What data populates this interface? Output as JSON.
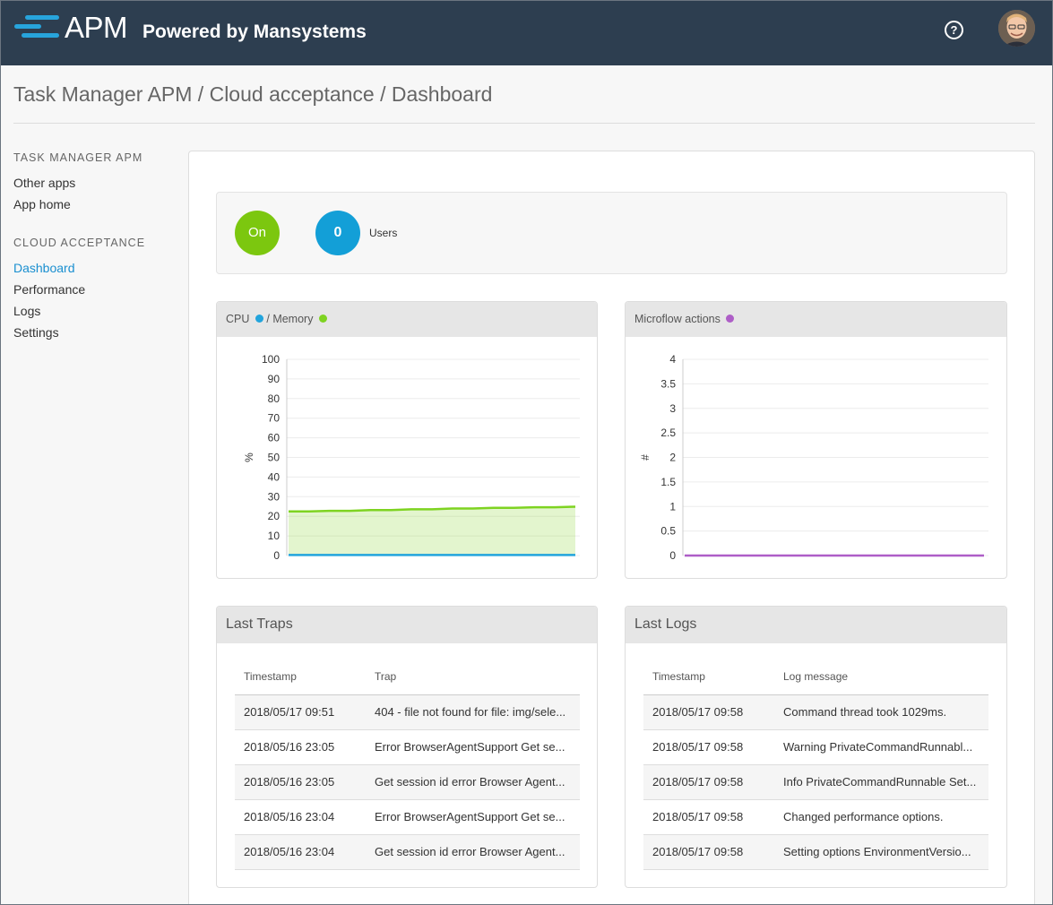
{
  "header": {
    "brand": "APM",
    "powered_by": "Powered by Mansystems",
    "help_icon": "question-circle-icon",
    "avatar": "user-avatar"
  },
  "breadcrumb": "Task Manager APM / Cloud acceptance / Dashboard",
  "sidebar": {
    "sections": [
      {
        "heading": "TASK MANAGER APM",
        "items": [
          {
            "label": "Other apps"
          },
          {
            "label": "App home"
          }
        ]
      },
      {
        "heading": "CLOUD ACCEPTANCE",
        "items": [
          {
            "label": "Dashboard",
            "active": true
          },
          {
            "label": "Performance"
          },
          {
            "label": "Logs"
          },
          {
            "label": "Settings"
          }
        ]
      }
    ]
  },
  "status": {
    "state": "On",
    "users_count": "0",
    "users_label": "Users",
    "colors": {
      "on": "#7cc70f",
      "users": "#139fd7"
    }
  },
  "cpu_panel": {
    "title_cpu": "CPU",
    "title_sep": "/ Memory",
    "colors": {
      "cpu": "#22a4dc",
      "memory": "#7ed321"
    }
  },
  "microflow_panel": {
    "title": "Microflow actions",
    "color": "#ae5ec7"
  },
  "chart_data": [
    {
      "type": "area",
      "ylabel": "%",
      "ylim": [
        0,
        100
      ],
      "yticks": [
        "100",
        "90",
        "80",
        "70",
        "60",
        "50",
        "40",
        "30",
        "20",
        "10",
        "0"
      ],
      "grid": true,
      "series": [
        {
          "name": "Memory",
          "values": [
            22.5,
            22.5,
            22.8,
            22.8,
            23.2,
            23.2,
            23.6,
            23.6,
            24.0,
            24.0,
            24.3,
            24.3,
            24.6,
            24.6,
            24.9
          ]
        },
        {
          "name": "CPU",
          "values": [
            0.3,
            0.3,
            0.3,
            0.3,
            0.3,
            0.3,
            0.3,
            0.3,
            0.3,
            0.3,
            0.3,
            0.3,
            0.3,
            0.3,
            0.3
          ]
        }
      ]
    },
    {
      "type": "line",
      "ylabel": "#",
      "ylim": [
        0,
        4
      ],
      "yticks": [
        "4",
        "3.5",
        "3",
        "2.5",
        "2",
        "1.5",
        "1",
        "0.5",
        "0"
      ],
      "grid": true,
      "series": [
        {
          "name": "Microflow actions",
          "values": [
            0,
            0,
            0,
            0,
            0,
            0,
            0,
            0,
            0,
            0,
            0,
            0,
            0,
            0,
            0
          ]
        }
      ]
    }
  ],
  "traps": {
    "title": "Last Traps",
    "columns": [
      "Timestamp",
      "Trap"
    ],
    "rows": [
      [
        "2018/05/17 09:51",
        "404 - file not found for file: img/sele..."
      ],
      [
        "2018/05/16 23:05",
        "Error BrowserAgentSupport Get se..."
      ],
      [
        "2018/05/16 23:05",
        "Get session id error Browser Agent..."
      ],
      [
        "2018/05/16 23:04",
        "Error BrowserAgentSupport Get se..."
      ],
      [
        "2018/05/16 23:04",
        "Get session id error Browser Agent..."
      ]
    ]
  },
  "logs": {
    "title": "Last Logs",
    "columns": [
      "Timestamp",
      "Log message"
    ],
    "rows": [
      [
        "2018/05/17 09:58",
        "Command thread took 1029ms."
      ],
      [
        "2018/05/17 09:58",
        "Warning PrivateCommandRunnabl..."
      ],
      [
        "2018/05/17 09:58",
        "Info PrivateCommandRunnable Set..."
      ],
      [
        "2018/05/17 09:58",
        "Changed performance options."
      ],
      [
        "2018/05/17 09:58",
        "Setting options EnvironmentVersio..."
      ]
    ]
  }
}
